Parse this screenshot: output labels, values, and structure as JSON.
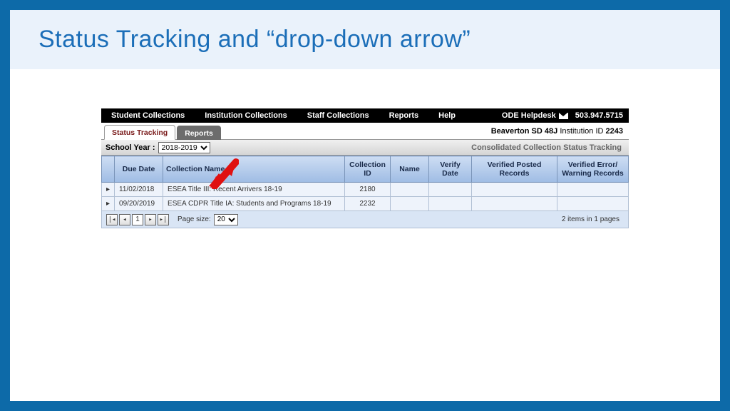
{
  "slide": {
    "title": "Status Tracking and “drop-down arrow”"
  },
  "topbar": {
    "nav": [
      "Student Collections",
      "Institution Collections",
      "Staff Collections",
      "Reports",
      "Help"
    ],
    "helpdesk_label": "ODE Helpdesk",
    "phone": "503.947.5715"
  },
  "tabs": {
    "active": "Status Tracking",
    "inactive": "Reports",
    "institution_prefix": "Beaverton SD 48J",
    "institution_id_label": "Institution ID",
    "institution_id": "2243"
  },
  "filter": {
    "label": "School Year :",
    "school_year": "2018-2019",
    "subtitle": "Consolidated Collection Status Tracking"
  },
  "grid": {
    "headers": {
      "due_date": "Due Date",
      "collection_name": "Collection Name",
      "collection_id": "Collection ID",
      "name": "Name",
      "verify_date": "Verify Date",
      "verified_posted_records": "Verified Posted Records",
      "verified_error_warning_records": "Verified Error/ Warning Records"
    },
    "rows": [
      {
        "due_date": "11/02/2018",
        "collection_name": "ESEA Title III: Recent Arrivers 18-19",
        "collection_id": "2180"
      },
      {
        "due_date": "09/20/2019",
        "collection_name": "ESEA CDPR Title IA: Students and Programs 18-19",
        "collection_id": "2232"
      }
    ]
  },
  "pager": {
    "page": "1",
    "page_size_label": "Page size:",
    "page_size": "20",
    "summary": "2 items in 1 pages"
  }
}
